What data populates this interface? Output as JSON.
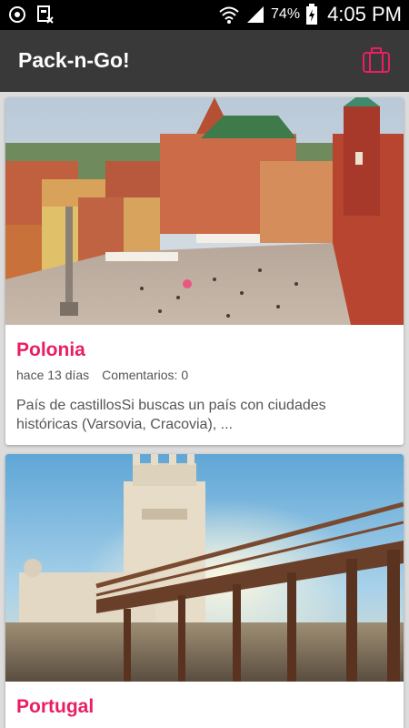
{
  "status_bar": {
    "battery_percent": "74%",
    "time": "4:05 PM"
  },
  "app_bar": {
    "title": "Pack-n-Go!",
    "action_icon": "suitcase-icon",
    "accent_color": "#e91e63"
  },
  "posts": [
    {
      "title": "Polonia",
      "date": "hace 13 días",
      "comments": "Comentarios: 0",
      "excerpt": "País de castillosSi buscas un país con ciudades históricas (Varsovia, Cracovia), ..."
    },
    {
      "title": "Portugal"
    }
  ]
}
